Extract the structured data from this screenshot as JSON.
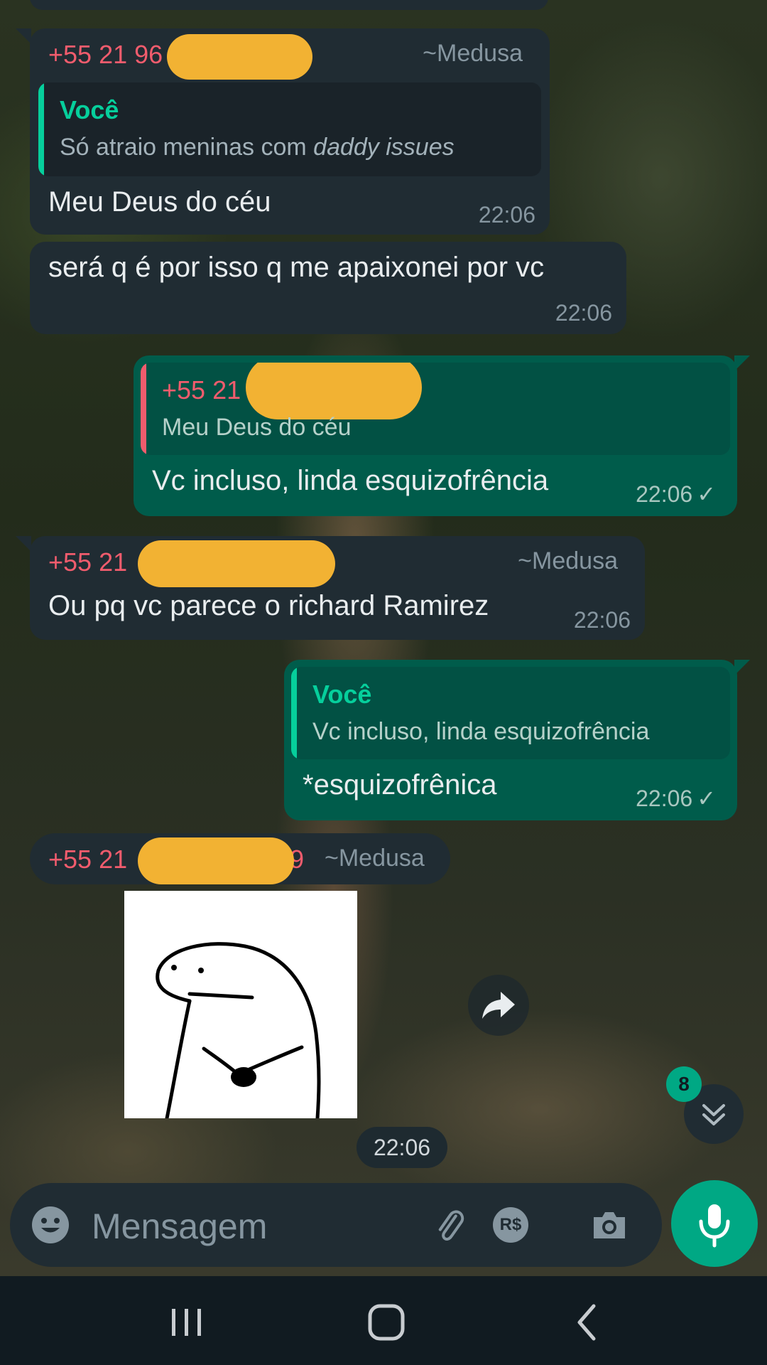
{
  "messages": [
    {
      "sender": "+55 21 96",
      "alias": "~Medusa",
      "quote_author": "Você",
      "quote_text_prefix": "Só atraio meninas com ",
      "quote_text_italic": "daddy issues",
      "text": "Meu Deus do céu",
      "time": "22:06"
    },
    {
      "text": "será q é por isso q me apaixonei por vc",
      "time": "22:06"
    },
    {
      "quote_author": "+55 21",
      "quote_text": "Meu Deus do céu",
      "text": "Vc incluso, linda esquizofrência",
      "time": "22:06",
      "status": "✓"
    },
    {
      "sender": "+55 21",
      "alias": "~Medusa",
      "text": "Ou pq vc parece o richard Ramirez",
      "time": "22:06"
    },
    {
      "quote_author": "Você",
      "quote_text": "Vc incluso, linda esquizofrência",
      "text": "*esquizofrênica",
      "time": "22:06",
      "status": "✓"
    },
    {
      "sender": "+55 21",
      "sender_trailing": "9",
      "alias": "~Medusa"
    }
  ],
  "sticker_time": "22:06",
  "scroll_badge": "8",
  "composer": {
    "placeholder": "Mensagem",
    "currency_icon_text": "R$"
  },
  "colors": {
    "incoming_bubble": "#202c33",
    "outgoing_bubble": "#005c4b",
    "accent": "#00a884",
    "sender_name": "#f15c6d",
    "redaction": "#f2b233"
  },
  "icons": [
    "emoji-icon",
    "attach-icon",
    "payment-icon",
    "camera-icon",
    "mic-icon",
    "forward-icon",
    "double-chevron-down-icon",
    "recents-icon",
    "home-icon",
    "back-icon"
  ]
}
